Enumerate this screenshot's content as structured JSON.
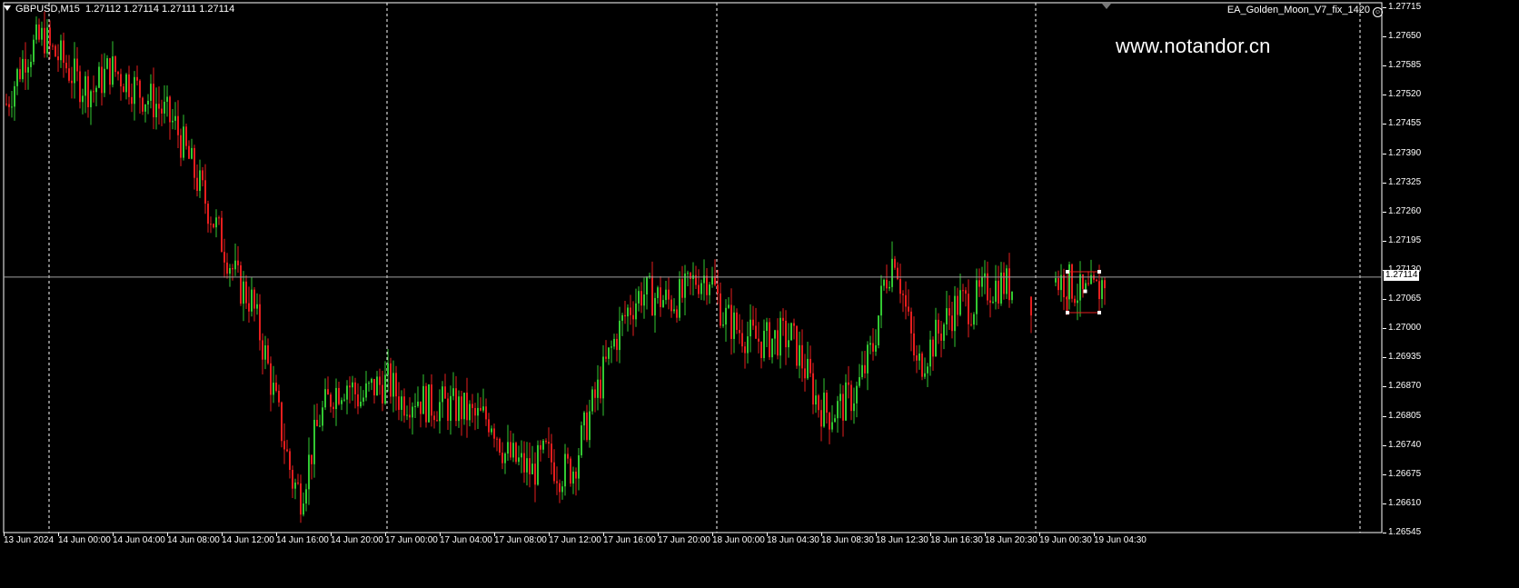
{
  "header": {
    "symbol": "GBPUSD,M15",
    "ohlc": "1.27112 1.27114 1.27111 1.27114",
    "ea_name": "EA_Golden_Moon_V7_fix_1420"
  },
  "watermark": "www.notandor.cn",
  "colors": {
    "background": "#000000",
    "bull": "#32c832",
    "bear": "#e61e1e",
    "grid": "#ffffff",
    "bid_line": "#a0a0a0"
  },
  "price_scale": {
    "labels": [
      "1.27715",
      "1.27650",
      "1.27585",
      "1.27520",
      "1.27455",
      "1.27390",
      "1.27325",
      "1.27260",
      "1.27195",
      "1.27130",
      "1.27065",
      "1.27000",
      "1.26935",
      "1.26870",
      "1.26805",
      "1.26740",
      "1.26675",
      "1.26610",
      "1.26545"
    ],
    "current_price": "1.27114"
  },
  "time_scale": {
    "labels": [
      "13 Jun 2024",
      "14 Jun 00:00",
      "14 Jun 04:00",
      "14 Jun 08:00",
      "14 Jun 12:00",
      "14 Jun 16:00",
      "14 Jun 20:00",
      "17 Jun 00:00",
      "17 Jun 04:00",
      "17 Jun 08:00",
      "17 Jun 12:00",
      "17 Jun 16:00",
      "17 Jun 20:00",
      "18 Jun 00:00",
      "18 Jun 04:30",
      "18 Jun 08:30",
      "18 Jun 12:30",
      "18 Jun 16:30",
      "18 Jun 20:30",
      "19 Jun 00:30",
      "19 Jun 04:30"
    ]
  },
  "chart_data": {
    "type": "candlestick",
    "title": "GBPUSD,M15",
    "ylim": [
      1.26545,
      1.27725
    ],
    "grid": "day separators",
    "bid_line": 1.27114,
    "close_anchors": [
      [
        0,
        1.275
      ],
      [
        7,
        1.2761
      ],
      [
        14,
        1.2765
      ],
      [
        16,
        1.2762
      ],
      [
        20,
        1.276
      ],
      [
        26,
        1.2755
      ],
      [
        32,
        1.2753
      ],
      [
        38,
        1.2758
      ],
      [
        45,
        1.2755
      ],
      [
        50,
        1.2752
      ],
      [
        55,
        1.275
      ],
      [
        62,
        1.2745
      ],
      [
        70,
        1.2733
      ],
      [
        80,
        1.2718
      ],
      [
        85,
        1.271
      ],
      [
        90,
        1.2706
      ],
      [
        95,
        1.2694
      ],
      [
        100,
        1.268
      ],
      [
        105,
        1.2666
      ],
      [
        108,
        1.2663
      ],
      [
        115,
        1.268
      ],
      [
        120,
        1.2686
      ],
      [
        125,
        1.2688
      ],
      [
        130,
        1.2684
      ],
      [
        135,
        1.2687
      ],
      [
        140,
        1.2688
      ],
      [
        145,
        1.2684
      ],
      [
        150,
        1.2685
      ],
      [
        155,
        1.2683
      ],
      [
        160,
        1.2683
      ],
      [
        167,
        1.2682
      ],
      [
        172,
        1.268
      ],
      [
        178,
        1.268
      ],
      [
        183,
        1.2672
      ],
      [
        188,
        1.267
      ],
      [
        193,
        1.2668
      ],
      [
        198,
        1.2672
      ],
      [
        203,
        1.2668
      ],
      [
        208,
        1.2669
      ],
      [
        213,
        1.2679
      ],
      [
        218,
        1.2688
      ],
      [
        223,
        1.2697
      ],
      [
        228,
        1.2704
      ],
      [
        233,
        1.2708
      ],
      [
        238,
        1.2707
      ],
      [
        243,
        1.2706
      ],
      [
        248,
        1.2707
      ],
      [
        253,
        1.2711
      ],
      [
        258,
        1.2712
      ],
      [
        263,
        1.2703
      ],
      [
        268,
        1.27
      ],
      [
        273,
        1.2698
      ],
      [
        278,
        1.2697
      ],
      [
        283,
        1.2698
      ],
      [
        288,
        1.2698
      ],
      [
        293,
        1.2691
      ],
      [
        298,
        1.2683
      ],
      [
        302,
        1.2681
      ],
      [
        307,
        1.2683
      ],
      [
        312,
        1.2686
      ],
      [
        318,
        1.2696
      ],
      [
        322,
        1.271
      ],
      [
        326,
        1.2717
      ],
      [
        330,
        1.2704
      ],
      [
        334,
        1.2691
      ],
      [
        338,
        1.2695
      ],
      [
        342,
        1.2699
      ],
      [
        346,
        1.2703
      ],
      [
        350,
        1.2706
      ],
      [
        354,
        1.2705
      ],
      [
        360,
        1.2709
      ],
      [
        365,
        1.271
      ],
      [
        370,
        1.2709
      ],
      [
        375,
        1.2707
      ],
      [
        380,
        1.2707
      ],
      [
        385,
        1.2711
      ],
      [
        390,
        1.271
      ],
      [
        395,
        1.2707
      ],
      [
        400,
        1.2708
      ],
      [
        403,
        1.2711
      ]
    ]
  }
}
